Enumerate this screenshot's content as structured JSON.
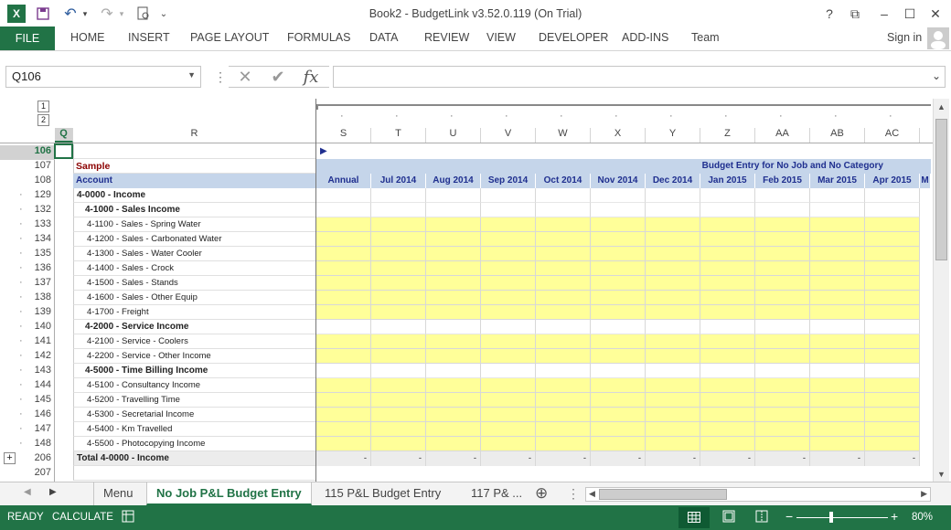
{
  "window": {
    "title": "Book2 - BudgetLink v3.52.0.119 (On Trial)",
    "help": "?",
    "restore_ribbon": "⧉",
    "minimize": "–",
    "maximize": "☐",
    "close": "✕"
  },
  "qat": {
    "excel_logo": "X",
    "save": "💾",
    "undo": "↶",
    "redo": "↷",
    "preview": "🗋",
    "more": "⌄"
  },
  "ribbon": {
    "file": "FILE",
    "tabs": [
      "HOME",
      "INSERT",
      "PAGE LAYOUT",
      "FORMULAS",
      "DATA",
      "REVIEW",
      "VIEW",
      "DEVELOPER",
      "ADD-INS",
      "Team"
    ],
    "sign_in": "Sign in"
  },
  "formula_bar": {
    "name_box": "Q106",
    "cancel": "✕",
    "enter": "✔",
    "fx": "fx",
    "formula": ""
  },
  "outline": {
    "level1": "1",
    "level2": "2",
    "col_level1": "1",
    "col_level2": "2",
    "dot": "·",
    "plus": "+"
  },
  "grid": {
    "col_letters": [
      "Q",
      "R",
      "S",
      "T",
      "U",
      "V",
      "W",
      "X",
      "Y",
      "Z",
      "AA",
      "AB",
      "AC"
    ],
    "sample_label": "Sample",
    "account_label": "Account",
    "banner": "Budget Entry  for No Job and No Category",
    "row_marker": "▶",
    "months": [
      "Annual",
      "Jul 2014",
      "Aug 2014",
      "Sep 2014",
      "Oct 2014",
      "Nov 2014",
      "Dec 2014",
      "Jan 2015",
      "Feb 2015",
      "Mar 2015",
      "Apr 2015",
      "M"
    ],
    "rows": [
      {
        "num": "106",
        "label": "",
        "style": "sel"
      },
      {
        "num": "107",
        "label": "",
        "style": "blank"
      },
      {
        "num": "108",
        "label": "",
        "style": "blank"
      },
      {
        "num": "129",
        "label": "4-0000 - Income",
        "style": "h0"
      },
      {
        "num": "132",
        "label": "4-1000 - Sales Income",
        "style": "h1"
      },
      {
        "num": "133",
        "label": "4-1100 - Sales - Spring Water",
        "style": "d"
      },
      {
        "num": "134",
        "label": "4-1200 - Sales - Carbonated Water",
        "style": "d"
      },
      {
        "num": "135",
        "label": "4-1300 - Sales - Water Cooler",
        "style": "d"
      },
      {
        "num": "136",
        "label": "4-1400 - Sales - Crock",
        "style": "d"
      },
      {
        "num": "137",
        "label": "4-1500 - Sales - Stands",
        "style": "d"
      },
      {
        "num": "138",
        "label": "4-1600 - Sales - Other Equip",
        "style": "d"
      },
      {
        "num": "139",
        "label": "4-1700 - Freight",
        "style": "d"
      },
      {
        "num": "140",
        "label": "4-2000 - Service Income",
        "style": "h1"
      },
      {
        "num": "141",
        "label": "4-2100 - Service - Coolers",
        "style": "d"
      },
      {
        "num": "142",
        "label": "4-2200 - Service - Other Income",
        "style": "d"
      },
      {
        "num": "143",
        "label": "4-5000 - Time Billing Income",
        "style": "h1"
      },
      {
        "num": "144",
        "label": "4-5100 - Consultancy Income",
        "style": "d"
      },
      {
        "num": "145",
        "label": "4-5200 - Travelling Time",
        "style": "d"
      },
      {
        "num": "146",
        "label": "4-5300 - Secretarial Income",
        "style": "d"
      },
      {
        "num": "147",
        "label": "4-5400 - Km Travelled",
        "style": "d"
      },
      {
        "num": "148",
        "label": "4-5500 - Photocopying Income",
        "style": "d"
      },
      {
        "num": "206",
        "label": "Total 4-0000 - Income",
        "style": "total"
      },
      {
        "num": "207",
        "label": "",
        "style": "blank"
      }
    ],
    "total_dash": "-"
  },
  "sheets": {
    "tabs": [
      "Menu",
      "No Job P&L Budget Entry",
      "115 P&L Budget Entry",
      "117 P& ..."
    ],
    "active": 1,
    "add": "⊕",
    "menu_dots": "⋮",
    "nav_prev": "◀",
    "nav_next": "▶"
  },
  "status": {
    "ready": "READY",
    "calculate": "CALCULATE",
    "zoom": "80%",
    "zoom_minus": "−",
    "zoom_plus": "+"
  },
  "colors": {
    "accent": "#217346",
    "yellow": "#ffff99",
    "band": "#c5d5ea",
    "header_blue": "#1f2f8f",
    "sample_red": "#8b0000"
  }
}
